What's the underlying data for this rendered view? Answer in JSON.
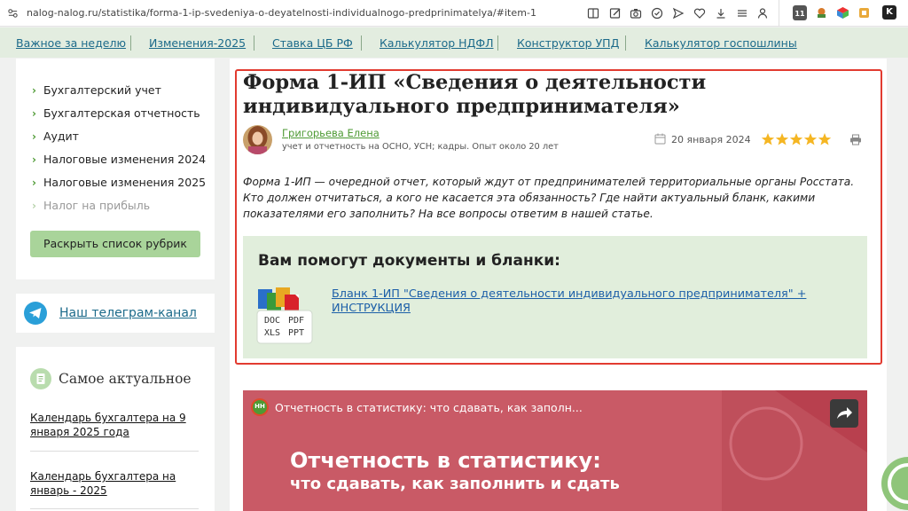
{
  "browser": {
    "url": "nalog-nalog.ru/statistika/forma-1-ip-svedeniya-o-deyatelnosti-individualnogo-predprinimatelya/#item-1",
    "ext_badge": "11",
    "ext_letter": "K"
  },
  "topnav": [
    "Важное за неделю",
    "Изменения-2025",
    "Ставка ЦБ РФ",
    "Калькулятор НДФЛ",
    "Конструктор УПД",
    "Калькулятор госпошлины"
  ],
  "sidebar": {
    "rubrics": [
      "Бухгалтерский учет",
      "Бухгалтерская отчетность",
      "Аудит",
      "Налоговые изменения 2024",
      "Налоговые изменения 2025",
      "Налог на прибыль"
    ],
    "expand_button": "Раскрыть список рубрик",
    "telegram_link": "Наш телеграм-канал",
    "actual_title": "Самое актуальное",
    "actual_links": [
      "Календарь бухгалтера на 9 января 2025 года",
      "Календарь бухгалтера на январь - 2025"
    ]
  },
  "article": {
    "title": "Форма 1-ИП «Сведения о деятельности индивидуального предпринимателя»",
    "author": "Григорьева Елена",
    "author_desc": "учет и отчетность на ОСНО, УСН; кадры. Опыт около 20 лет",
    "date": "20 января 2024",
    "rating": 5,
    "lead": "Форма 1-ИП — очередной отчет, который ждут от предпринимателей территориальные органы Росстата. Кто должен отчитаться, а кого не касается эта обязанность? Где найти актуальный бланк, какими показателями его заполнить? На все вопросы ответим в нашей статье.",
    "docs_title": "Вам помогут документы и бланки:",
    "doc_link": "Бланк 1-ИП \"Сведения о деятельности индивидуального предпринимателя\" + ИНСТРУКЦИЯ",
    "doc_formats": [
      "DOC",
      "PDF",
      "XLS",
      "PPT"
    ]
  },
  "video": {
    "channel_badge": "НН",
    "title": "Отчетность в статистику: что сдавать, как заполн...",
    "headline1": "Отчетность в статистику:",
    "headline2": "что сдавать, как заполнить и сдать"
  },
  "colors": {
    "accent_green": "#4e9a34",
    "link_blue": "#1c6a8a",
    "highlight_red": "#e23b30",
    "video_bg": "#c95a66"
  }
}
